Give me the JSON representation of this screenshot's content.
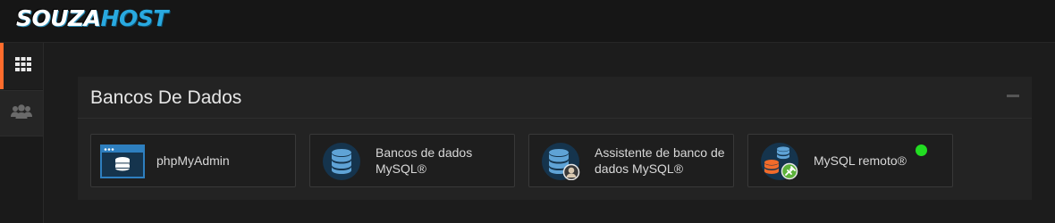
{
  "brand": {
    "logo_part1": "SOUZA",
    "logo_part2": "HOST"
  },
  "sidebar": {
    "items": [
      {
        "icon": "grid-icon",
        "active": true
      },
      {
        "icon": "users-icon",
        "active": false
      }
    ]
  },
  "panel": {
    "title": "Bancos De Dados",
    "tiles": [
      {
        "label": "phpMyAdmin",
        "icon": "phpmyadmin-icon"
      },
      {
        "label": "Bancos de dados MySQL®",
        "icon": "mysql-databases-icon"
      },
      {
        "label": "Assistente de banco de dados MySQL®",
        "icon": "mysql-wizard-icon"
      },
      {
        "label": "MySQL remoto®",
        "icon": "remote-mysql-icon"
      }
    ]
  },
  "colors": {
    "accent": "#ff6c2c",
    "brand_blue": "#29a9e0",
    "status_online": "#22dd22"
  }
}
